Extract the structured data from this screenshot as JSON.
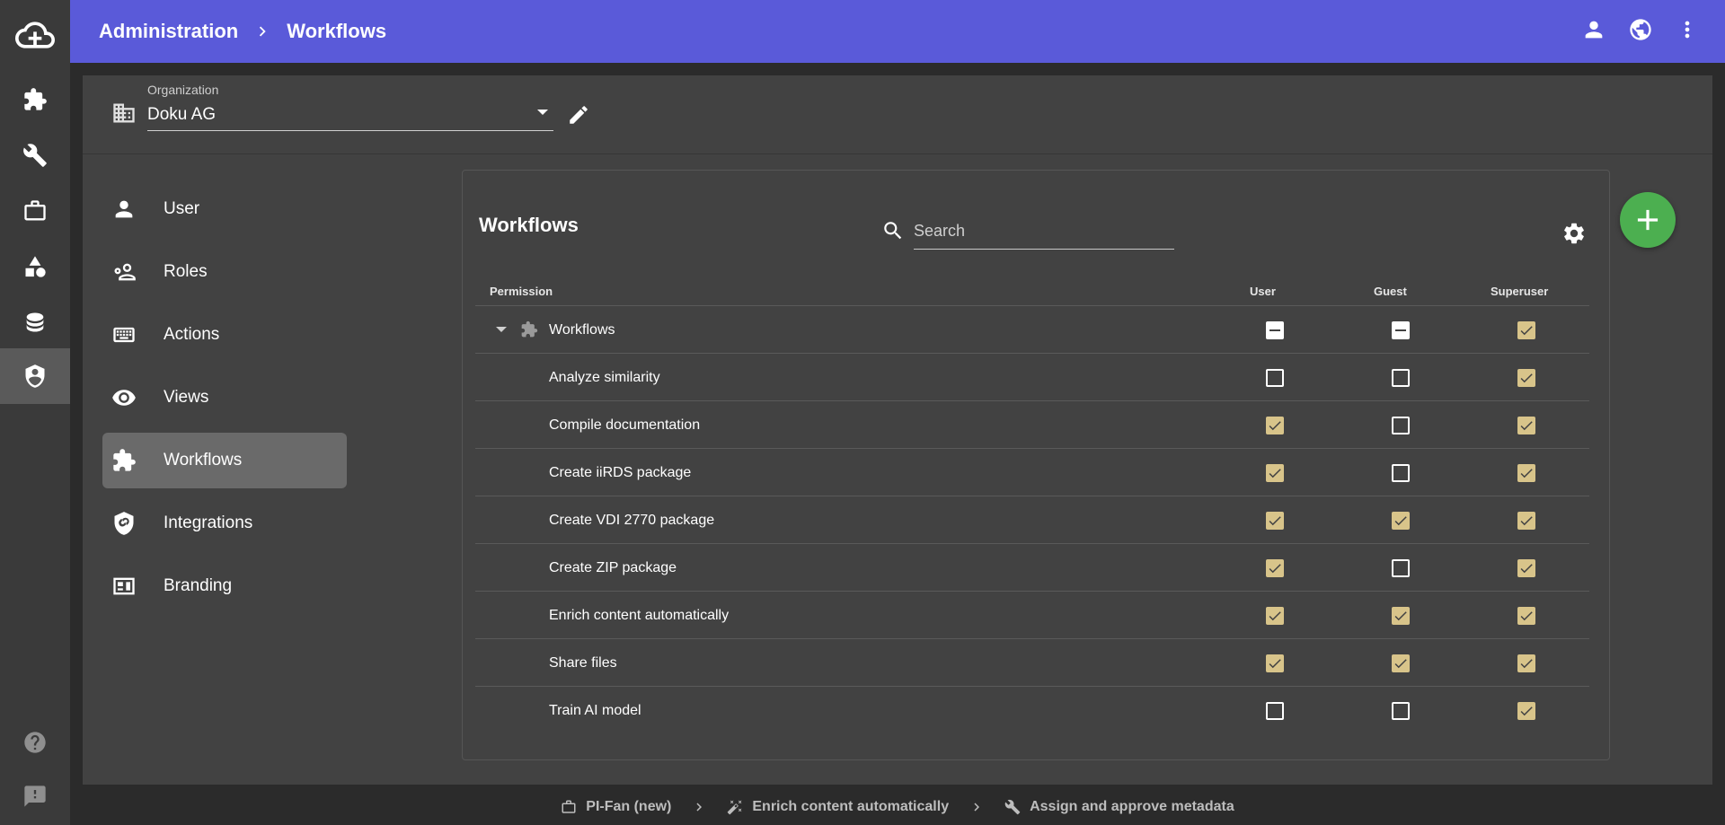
{
  "header": {
    "breadcrumb": [
      "Administration",
      "Workflows"
    ],
    "actions": [
      "account-icon",
      "globe-icon",
      "more-vert-icon"
    ],
    "color": "#5a5ad9"
  },
  "rail": {
    "logo": "cloud-plus-icon",
    "items": [
      "puzzle-icon",
      "wrench-icon",
      "briefcase-icon",
      "shapes-icon",
      "database-icon",
      "shield-account-icon"
    ],
    "active_index": 5,
    "bottom_items": [
      "help-icon",
      "feedback-icon"
    ]
  },
  "organization": {
    "label": "Organization",
    "value": "Doku AG"
  },
  "nav": {
    "items": [
      {
        "label": "User",
        "icon": "person-icon"
      },
      {
        "label": "Roles",
        "icon": "roles-icon"
      },
      {
        "label": "Actions",
        "icon": "keyboard-icon"
      },
      {
        "label": "Views",
        "icon": "eye-icon"
      },
      {
        "label": "Workflows",
        "icon": "puzzle-icon"
      },
      {
        "label": "Integrations",
        "icon": "shield-link-icon"
      },
      {
        "label": "Branding",
        "icon": "branding-icon"
      }
    ],
    "active_index": 4
  },
  "panel": {
    "title": "Workflows",
    "search_placeholder": "Search",
    "columns": [
      "Permission",
      "User",
      "Guest",
      "Superuser"
    ],
    "group": {
      "name": "Workflows",
      "user": "partial",
      "guest": "partial",
      "superuser": "on"
    },
    "rows": [
      {
        "name": "Analyze similarity",
        "user": "off",
        "guest": "off",
        "superuser": "on"
      },
      {
        "name": "Compile documentation",
        "user": "on",
        "guest": "off",
        "superuser": "on"
      },
      {
        "name": "Create iiRDS package",
        "user": "on",
        "guest": "off",
        "superuser": "on"
      },
      {
        "name": "Create VDI 2770 package",
        "user": "on",
        "guest": "on",
        "superuser": "on"
      },
      {
        "name": "Create ZIP package",
        "user": "on",
        "guest": "off",
        "superuser": "on"
      },
      {
        "name": "Enrich content automatically",
        "user": "on",
        "guest": "on",
        "superuser": "on"
      },
      {
        "name": "Share files",
        "user": "on",
        "guest": "on",
        "superuser": "on"
      },
      {
        "name": "Train AI model",
        "user": "off",
        "guest": "off",
        "superuser": "on"
      }
    ],
    "checked_color": "#d8c48a",
    "add_color": "#4caf50"
  },
  "footer": {
    "items": [
      {
        "label": "PI-Fan (new)",
        "icon": "briefcase-icon"
      },
      {
        "label": "Enrich content automatically",
        "icon": "wand-icon"
      },
      {
        "label": "Assign and approve metadata",
        "icon": "wrench-icon"
      }
    ]
  }
}
